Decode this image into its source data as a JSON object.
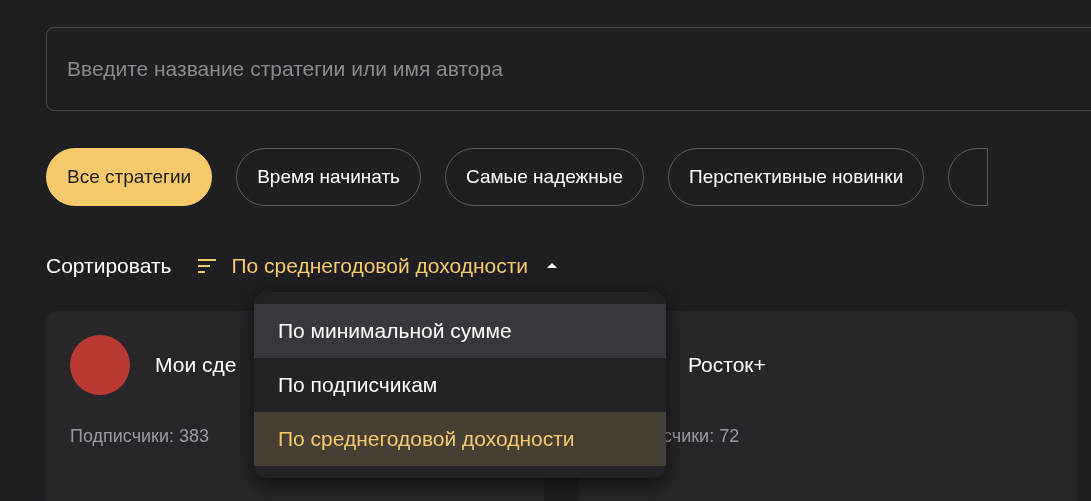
{
  "search": {
    "placeholder": "Введите название стратегии или имя автора"
  },
  "filters": [
    {
      "label": "Все стратегии",
      "selected": true
    },
    {
      "label": "Время начинать",
      "selected": false
    },
    {
      "label": "Самые надежные",
      "selected": false
    },
    {
      "label": "Перспективные новинки",
      "selected": false
    }
  ],
  "sort": {
    "label": "Сортировать",
    "value": "По среднегодовой доходности",
    "expanded": true,
    "options": [
      {
        "label": "По минимальной сумме",
        "hovered": true,
        "selected": false
      },
      {
        "label": "По подписчикам",
        "hovered": false,
        "selected": false
      },
      {
        "label": "По среднегодовой доходности",
        "hovered": false,
        "selected": true
      }
    ]
  },
  "cards": [
    {
      "title": "Мои сде",
      "subscribers": "Подписчики: 383",
      "avatar": true
    },
    {
      "title": "Росток+",
      "subscribers": "счики: 72",
      "avatar": false
    }
  ]
}
